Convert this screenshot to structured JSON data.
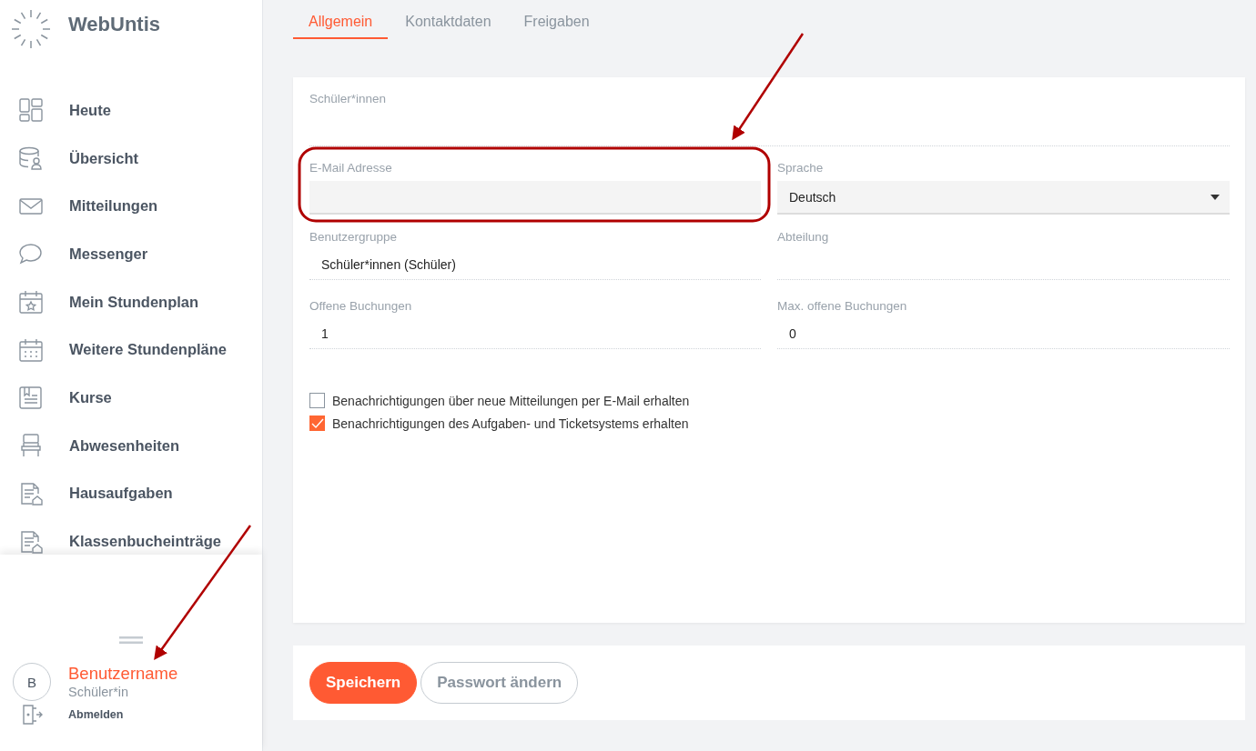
{
  "app": {
    "name": "WebUntis"
  },
  "nav": [
    {
      "label": "Heute"
    },
    {
      "label": "Übersicht"
    },
    {
      "label": "Mitteilungen"
    },
    {
      "label": "Messenger"
    },
    {
      "label": "Mein Stundenplan"
    },
    {
      "label": "Weitere Stundenpläne"
    },
    {
      "label": "Kurse"
    },
    {
      "label": "Abwesenheiten"
    },
    {
      "label": "Hausaufgaben"
    },
    {
      "label": "Klassenbucheinträge"
    }
  ],
  "user": {
    "initial": "B",
    "name": "Benutzername",
    "role": "Schüler*in",
    "logout": "Abmelden"
  },
  "tabs": [
    {
      "label": "Allgemein",
      "selected": true
    },
    {
      "label": "Kontaktdaten",
      "selected": false
    },
    {
      "label": "Freigaben",
      "selected": false
    }
  ],
  "form": {
    "section": "Schüler*innen",
    "fields": [
      {
        "label": "E-Mail Adresse",
        "kind": "input"
      },
      {
        "label": "Sprache",
        "kind": "select",
        "value": "Deutsch"
      },
      {
        "label": "Benutzergruppe",
        "kind": "readonly",
        "value": "Schüler*innen (Schüler)"
      },
      {
        "label": "Abteilung",
        "kind": "readonly"
      },
      {
        "label": "Offene Buchungen",
        "kind": "readonly",
        "value": "1"
      },
      {
        "label": "Max. offene Buchungen",
        "kind": "readonly",
        "value": "0"
      }
    ],
    "checkboxes": [
      {
        "label": "Benachrichtigungen über neue Mitteilungen per E-Mail erhalten",
        "checked": false
      },
      {
        "label": "Benachrichtigungen des Aufgaben- und Ticketsystems erhalten",
        "checked": true
      }
    ]
  },
  "buttons": [
    {
      "label": "Speichern",
      "kind": "primary"
    },
    {
      "label": "Passwort ändern",
      "kind": "secondary"
    }
  ]
}
